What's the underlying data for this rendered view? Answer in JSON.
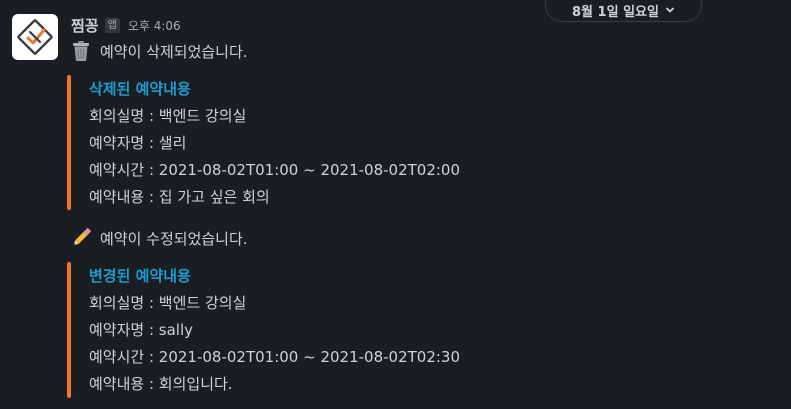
{
  "date_divider": {
    "label": "8월 1일 일요일"
  },
  "message": {
    "sender": "찜꽁",
    "badge": "앱",
    "time": "오후 4:06",
    "avatar_icon": "calendar-check-icon",
    "colors": {
      "accent_bar": "#f0762b",
      "title_link": "#1d9bd1",
      "background": "#1a1d21",
      "text": "#d1d2d3"
    }
  },
  "deleted": {
    "emoji": "wastebasket-icon",
    "text": "예약이 삭제되었습니다.",
    "title": "삭제된 예약내용",
    "rows": [
      "회의실명 : 백엔드 강의실",
      "예약자명 : 샐리",
      "예약시간 : 2021-08-02T01:00 ~ 2021-08-02T02:00",
      "예약내용 : 집 가고 싶은 회의"
    ]
  },
  "updated": {
    "emoji": "pencil-icon",
    "text": "예약이 수정되었습니다.",
    "title": "변경된 예약내용",
    "rows": [
      "회의실명 : 백엔드 강의실",
      "예약자명 : sally",
      "예약시간 : 2021-08-02T01:00 ~ 2021-08-02T02:30",
      "예약내용 : 회의입니다."
    ]
  }
}
